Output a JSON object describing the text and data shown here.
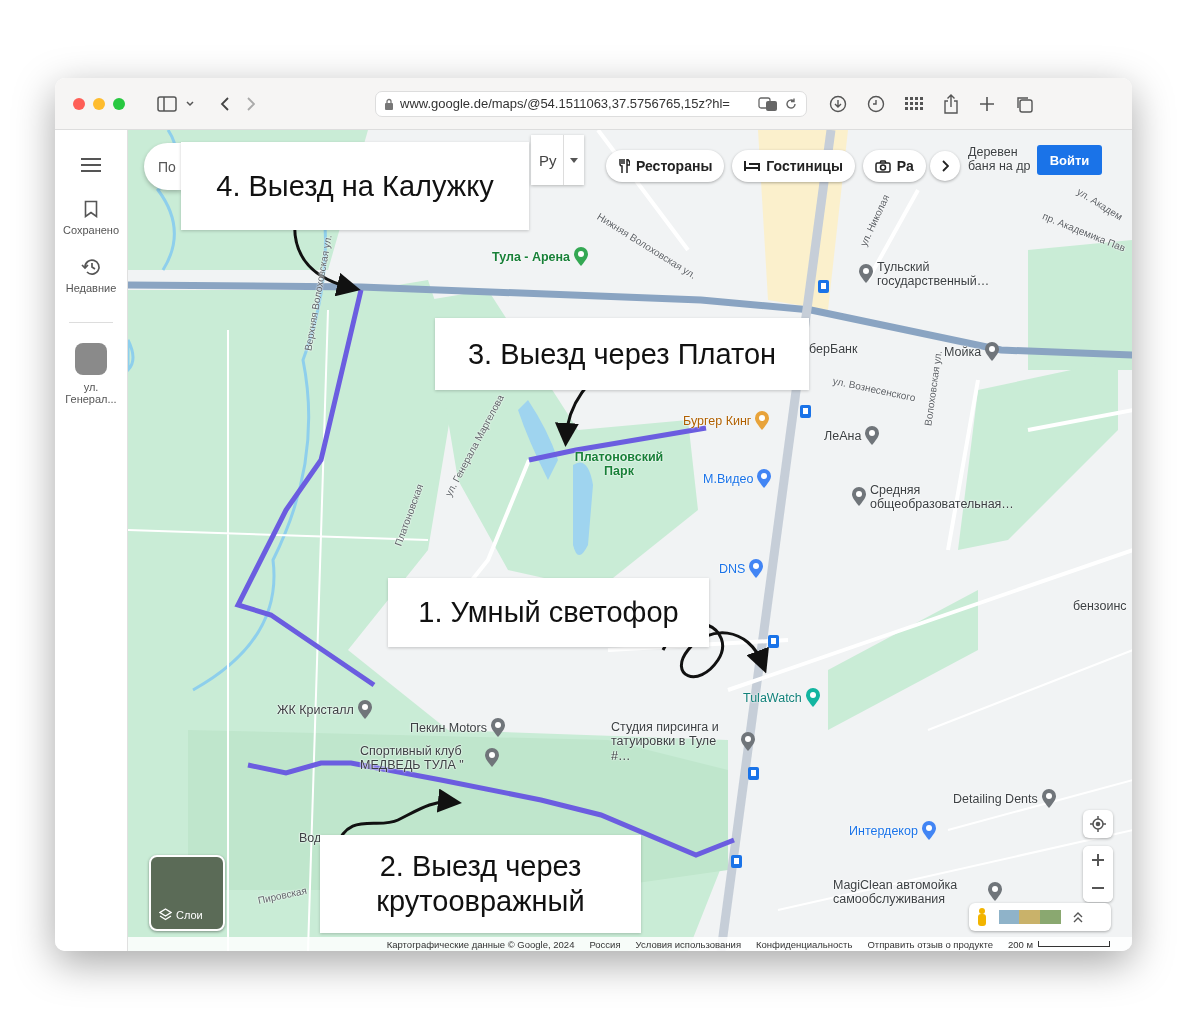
{
  "browser": {
    "url": "www.google.de/maps/@54.1511063,37.5756765,15z?hl="
  },
  "sidebar": {
    "items": [
      {
        "label": "Сохранено",
        "kind": "saved"
      },
      {
        "label": "Недавние",
        "kind": "recent"
      }
    ],
    "recent_place": "ул. Генерал..."
  },
  "search": {
    "placeholder": "По"
  },
  "language": "Ру",
  "chips": [
    {
      "label": "Рестораны",
      "kind": "food"
    },
    {
      "label": "Гостиницы",
      "kind": "hotel"
    },
    {
      "label": "Ра",
      "kind": "photo"
    }
  ],
  "sign_in": "Войти",
  "labels": [
    {
      "text": "Тула - Арена",
      "kind": "park"
    },
    {
      "text": "Тульский государственный…",
      "kind": "school"
    },
    {
      "text": "берБанк",
      "kind": "text"
    },
    {
      "text": "Мойка",
      "kind": "place"
    },
    {
      "text": "ул. Вознесенского",
      "kind": "street"
    },
    {
      "text": "Бургер Кинг",
      "kind": "food"
    },
    {
      "text": "ЛеАна",
      "kind": "place"
    },
    {
      "text": "Платоновский Парк",
      "kind": "parktext"
    },
    {
      "text": "М.Видео",
      "kind": "shop"
    },
    {
      "text": "Средняя общеобразовательная…",
      "kind": "school"
    },
    {
      "text": "DNS",
      "kind": "shop"
    },
    {
      "text": "бензоинс",
      "kind": "text"
    },
    {
      "text": "TulaWatch",
      "kind": "watch"
    },
    {
      "text": "ЖК Кристалл",
      "kind": "place"
    },
    {
      "text": "Пекин Motors",
      "kind": "place"
    },
    {
      "text": "Спортивный клуб МЕДВЕДЬ ТУЛА \"",
      "kind": "place"
    },
    {
      "text": "Студия пирсинга и татуировки в Туле #…",
      "kind": "place"
    },
    {
      "text": "Detailing Dents",
      "kind": "place"
    },
    {
      "text": "Интердекор",
      "kind": "shop"
    },
    {
      "text": "MagiClean автомойка самообслуживания",
      "kind": "place"
    },
    {
      "text": "Вод",
      "kind": "text"
    },
    {
      "text": "Пировская",
      "kind": "street"
    },
    {
      "text": "Верхняя Волоховская ул.",
      "kind": "street"
    },
    {
      "text": "Нижняя Волоховская ул.",
      "kind": "street"
    },
    {
      "text": "ул. Генерала Маргелова",
      "kind": "street"
    },
    {
      "text": "Платоновская",
      "kind": "street"
    },
    {
      "text": "ул. Николая",
      "kind": "street"
    },
    {
      "text": "Волоховская ул.",
      "kind": "street"
    },
    {
      "text": "ул. Академ",
      "kind": "street"
    },
    {
      "text": "пр. Академика Пав",
      "kind": "street"
    },
    {
      "text": "Деревен",
      "kind": "text"
    },
    {
      "text": "баня на др",
      "kind": "text"
    }
  ],
  "callouts": [
    "4. Выезд на Калужку",
    "3. Выезд через Платон",
    "1. Умный светофор",
    "2. Выезд через крутоовражный"
  ],
  "layers": "Слои",
  "footer": [
    "Картографические данные © Google, 2024",
    "Россия",
    "Условия использования",
    "Конфиденциальность",
    "Отправить отзыв о продукте"
  ],
  "scale": "200 м"
}
